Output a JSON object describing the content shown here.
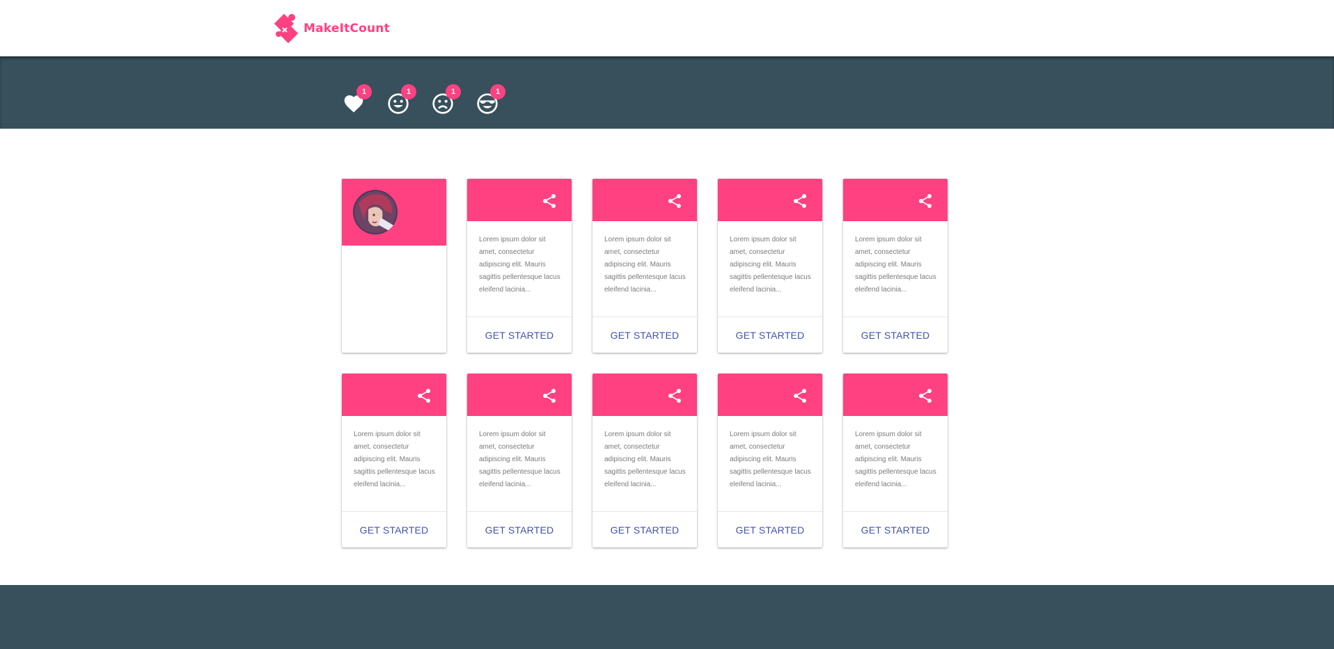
{
  "brand": {
    "name": "MakeItCount",
    "color": "#ff4081"
  },
  "stats": [
    {
      "icon": "heart-icon",
      "count": "1"
    },
    {
      "icon": "smile-icon",
      "count": "1"
    },
    {
      "icon": "frown-icon",
      "count": "1"
    },
    {
      "icon": "sunglasses-smile-icon",
      "count": "1"
    }
  ],
  "profile": {
    "avatar": "avatar"
  },
  "cards": [
    {
      "text": "Lorem ipsum dolor sit amet, consectetur adipiscing elit. Mauris sagittis pellentesque lacus eleifend lacinia...",
      "button": "GET STARTED"
    },
    {
      "text": "Lorem ipsum dolor sit amet, consectetur adipiscing elit. Mauris sagittis pellentesque lacus eleifend lacinia...",
      "button": "GET STARTED"
    },
    {
      "text": "Lorem ipsum dolor sit amet, consectetur adipiscing elit. Mauris sagittis pellentesque lacus eleifend lacinia...",
      "button": "GET STARTED"
    },
    {
      "text": "Lorem ipsum dolor sit amet, consectetur adipiscing elit. Mauris sagittis pellentesque lacus eleifend lacinia...",
      "button": "GET STARTED"
    },
    {
      "text": "Lorem ipsum dolor sit amet, consectetur adipiscing elit. Mauris sagittis pellentesque lacus eleifend lacinia...",
      "button": "GET STARTED"
    },
    {
      "text": "Lorem ipsum dolor sit amet, consectetur adipiscing elit. Mauris sagittis pellentesque lacus eleifend lacinia...",
      "button": "GET STARTED"
    },
    {
      "text": "Lorem ipsum dolor sit amet, consectetur adipiscing elit. Mauris sagittis pellentesque lacus eleifend lacinia...",
      "button": "GET STARTED"
    },
    {
      "text": "Lorem ipsum dolor sit amet, consectetur adipiscing elit. Mauris sagittis pellentesque lacus eleifend lacinia...",
      "button": "GET STARTED"
    },
    {
      "text": "Lorem ipsum dolor sit amet, consectetur adipiscing elit. Mauris sagittis pellentesque lacus eleifend lacinia...",
      "button": "GET STARTED"
    }
  ],
  "colors": {
    "header_band": "#37505c",
    "accent": "#ff4081",
    "button_text": "#3f51b5"
  }
}
